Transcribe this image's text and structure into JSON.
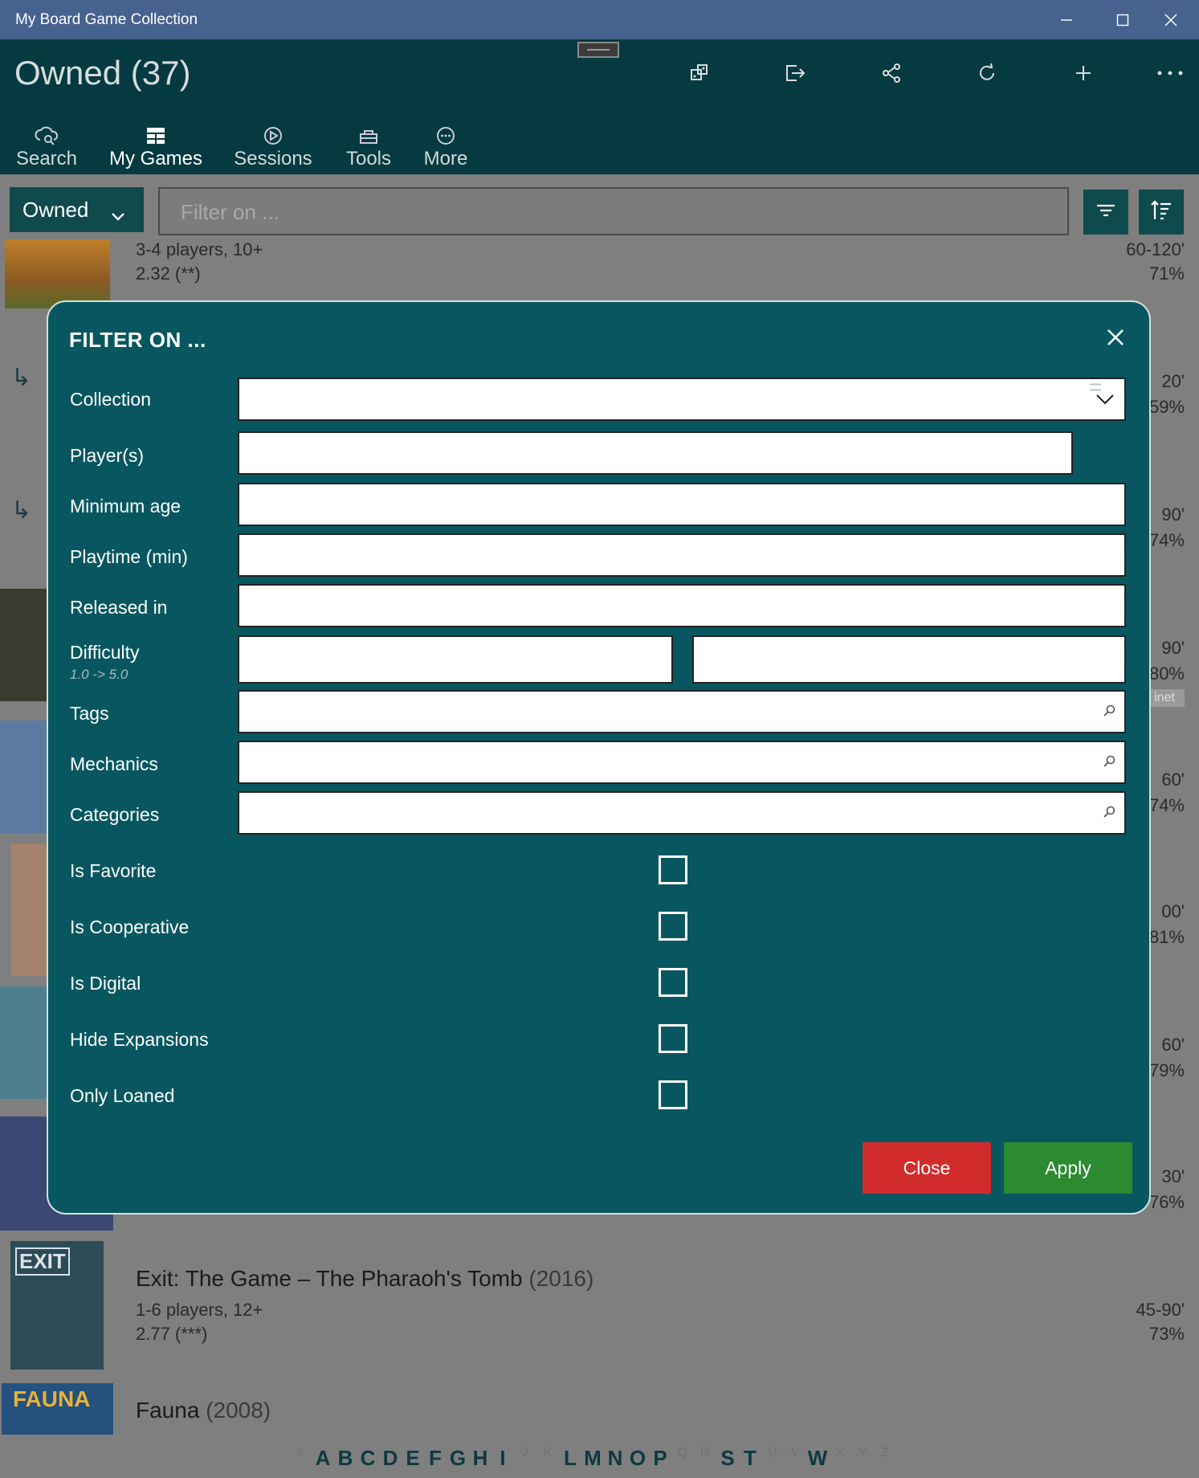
{
  "window": {
    "title": "My Board Game Collection"
  },
  "header": {
    "page_title": "Owned (37)"
  },
  "nav": [
    {
      "label": "Search"
    },
    {
      "label": "My Games"
    },
    {
      "label": "Sessions"
    },
    {
      "label": "Tools"
    },
    {
      "label": "More"
    }
  ],
  "toolbar": {
    "collection_selected": "Owned",
    "filter_placeholder": "Filter on ..."
  },
  "background_rows": [
    {
      "players": "3-4 players, 10+",
      "rating": "2.32 (**)",
      "time": "60-120'",
      "percent": "71%"
    },
    {
      "time": "20'",
      "percent": "59%"
    },
    {
      "time": "90'",
      "percent": "74%"
    },
    {
      "time": "90'",
      "percent": "80%",
      "badge": "inet"
    },
    {
      "time": "60'",
      "percent": "74%"
    },
    {
      "time": "00'",
      "percent": "81%"
    },
    {
      "time": "60'",
      "percent": "79%"
    },
    {
      "time": "30'",
      "percent": "76%"
    }
  ],
  "games": [
    {
      "title": "Exit: The Game – The Pharaoh's Tomb",
      "year": "(2016)",
      "players": "1-6 players, 12+",
      "rating": "2.77 (***)",
      "time": "45-90'",
      "percent": "73%"
    },
    {
      "title": "Fauna",
      "year": "(2008)"
    }
  ],
  "alphabet": [
    {
      "ch": "#",
      "on": false
    },
    {
      "ch": "A",
      "on": true
    },
    {
      "ch": "B",
      "on": true
    },
    {
      "ch": "C",
      "on": true
    },
    {
      "ch": "D",
      "on": true
    },
    {
      "ch": "E",
      "on": true
    },
    {
      "ch": "F",
      "on": true
    },
    {
      "ch": "G",
      "on": true
    },
    {
      "ch": "H",
      "on": true
    },
    {
      "ch": "I",
      "on": true
    },
    {
      "ch": "J",
      "on": false
    },
    {
      "ch": "K",
      "on": false
    },
    {
      "ch": "L",
      "on": true
    },
    {
      "ch": "M",
      "on": true
    },
    {
      "ch": "N",
      "on": true
    },
    {
      "ch": "O",
      "on": true
    },
    {
      "ch": "P",
      "on": true
    },
    {
      "ch": "Q",
      "on": false
    },
    {
      "ch": "R",
      "on": false
    },
    {
      "ch": "S",
      "on": true
    },
    {
      "ch": "T",
      "on": true
    },
    {
      "ch": "U",
      "on": false
    },
    {
      "ch": "V",
      "on": false
    },
    {
      "ch": "W",
      "on": true
    },
    {
      "ch": "X",
      "on": false
    },
    {
      "ch": "Y",
      "on": false
    },
    {
      "ch": "Z",
      "on": false
    }
  ],
  "modal": {
    "title": "FILTER ON ...",
    "fields": {
      "collection": "Collection",
      "players": "Player(s)",
      "min_age": "Minimum age",
      "playtime": "Playtime (min)",
      "released": "Released in",
      "difficulty": "Difficulty",
      "difficulty_hint": "1.0 -> 5.0",
      "tags": "Tags",
      "mechanics": "Mechanics",
      "categories": "Categories"
    },
    "players_operator": "=",
    "range_separator": "-",
    "checkboxes": {
      "favorite": "Is Favorite",
      "cooperative": "Is Cooperative",
      "digital": "Is Digital",
      "hide_expansions": "Hide Expansions",
      "only_loaned": "Only Loaned"
    },
    "close_label": "Close",
    "apply_label": "Apply"
  },
  "colors": {
    "titlebar": "#46638f",
    "appbar": "#043a40",
    "modal_bg": "#085760",
    "close_btn": "#d22b2b",
    "apply_btn": "#2c8a30"
  }
}
